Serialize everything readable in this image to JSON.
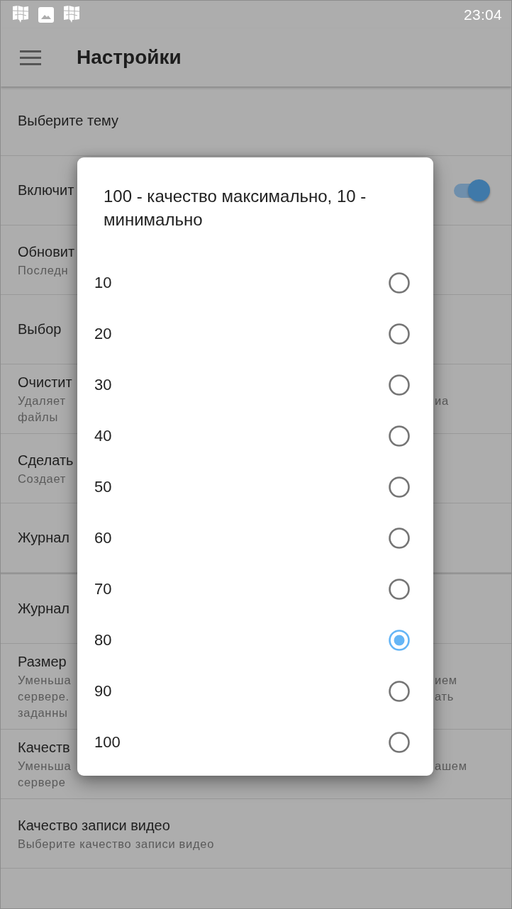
{
  "status_bar": {
    "time": "23:04"
  },
  "toolbar": {
    "title": "Настройки"
  },
  "settings": {
    "sections": [
      {
        "items": [
          {
            "kind": "text",
            "title": "Выберите тему"
          },
          {
            "kind": "switch",
            "title": "Включит",
            "on": true
          },
          {
            "kind": "text",
            "title": "Обновит",
            "lines": [
              {
                "text": "Последн"
              }
            ]
          },
          {
            "kind": "text",
            "title": "Выбор"
          },
          {
            "kind": "text",
            "title": "Очистит",
            "lines": [
              {
                "text": "Удаляет",
                "tail": "иа"
              },
              {
                "text": "файлы"
              }
            ]
          },
          {
            "kind": "text",
            "title": "Сделать",
            "lines": [
              {
                "text": "Создает"
              }
            ]
          },
          {
            "kind": "text",
            "title": "Журнал"
          }
        ]
      },
      {
        "items": [
          {
            "kind": "text",
            "title": "Журнал"
          },
          {
            "kind": "text",
            "title": "Размер",
            "lines": [
              {
                "text": "Уменьша",
                "tail": "ием"
              },
              {
                "text": "сервере.",
                "tail": "ать"
              },
              {
                "text": "заданны"
              }
            ]
          },
          {
            "kind": "text",
            "title": "Качеств",
            "lines": [
              {
                "text": "Уменьша",
                "tail": "ашем"
              },
              {
                "text": "сервере"
              }
            ]
          },
          {
            "kind": "text",
            "title": "Качество записи видео",
            "lines": [
              {
                "text": "Выберите качество записи видео"
              }
            ]
          }
        ]
      }
    ]
  },
  "dialog": {
    "title": "100 - качество максимально, 10 - минимально",
    "options": [
      {
        "label": "10",
        "selected": false
      },
      {
        "label": "20",
        "selected": false
      },
      {
        "label": "30",
        "selected": false
      },
      {
        "label": "40",
        "selected": false
      },
      {
        "label": "50",
        "selected": false
      },
      {
        "label": "60",
        "selected": false
      },
      {
        "label": "70",
        "selected": false
      },
      {
        "label": "80",
        "selected": true
      },
      {
        "label": "90",
        "selected": false
      },
      {
        "label": "100",
        "selected": false
      }
    ]
  }
}
